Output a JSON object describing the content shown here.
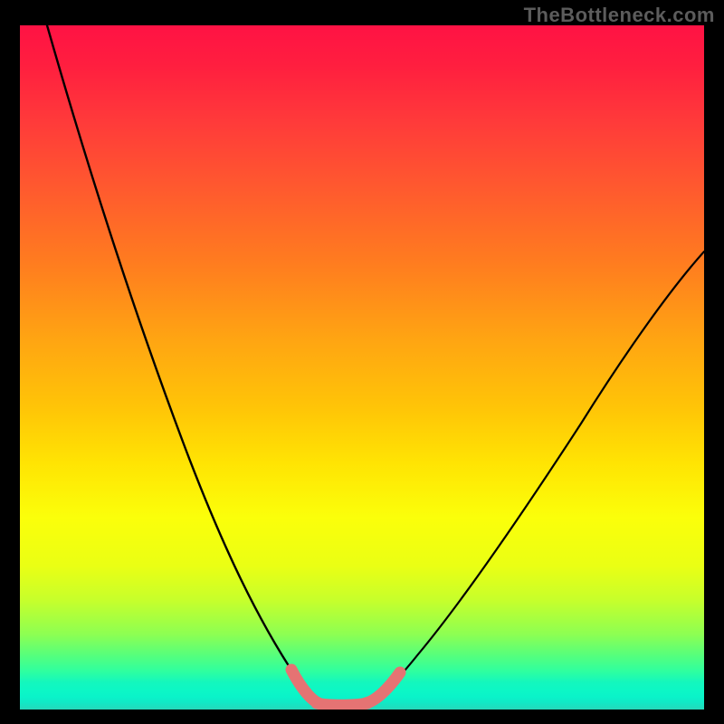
{
  "watermark": "TheBottleneck.com",
  "colors": {
    "background": "#000000",
    "curve": "#000000",
    "highlight": "#e57373",
    "watermark": "#5c5c5c"
  },
  "chart_data": {
    "type": "line",
    "title": "",
    "xlabel": "",
    "ylabel": "",
    "xlim": [
      0,
      100
    ],
    "ylim": [
      0,
      100
    ],
    "grid": false,
    "legend": false,
    "series": [
      {
        "name": "left-curve",
        "x": [
          4,
          8,
          12,
          16,
          20,
          24,
          28,
          32,
          36,
          38,
          40,
          41.5,
          43
        ],
        "y": [
          100,
          84,
          70,
          58,
          47,
          37,
          28,
          20,
          12,
          8,
          4.5,
          2.5,
          1
        ]
      },
      {
        "name": "right-curve",
        "x": [
          50,
          52,
          55,
          60,
          65,
          70,
          75,
          80,
          85,
          90,
          95,
          100
        ],
        "y": [
          1,
          2.5,
          5,
          10,
          16,
          22.5,
          29,
          36,
          43,
          50,
          57,
          64
        ]
      },
      {
        "name": "valley-floor",
        "x": [
          43,
          45,
          47,
          50
        ],
        "y": [
          1,
          0.6,
          0.6,
          1
        ]
      },
      {
        "name": "highlight-left",
        "x": [
          40,
          41.5,
          43
        ],
        "y": [
          4.5,
          2.5,
          1
        ]
      },
      {
        "name": "highlight-floor",
        "x": [
          43,
          45,
          47,
          50
        ],
        "y": [
          1,
          0.6,
          0.6,
          1
        ]
      },
      {
        "name": "highlight-right",
        "x": [
          50,
          52,
          55
        ],
        "y": [
          1,
          2.5,
          5
        ]
      }
    ],
    "gradient_stops": [
      {
        "pos": 0.0,
        "color": "#ff1244"
      },
      {
        "pos": 0.06,
        "color": "#ff1f3f"
      },
      {
        "pos": 0.14,
        "color": "#ff3a3a"
      },
      {
        "pos": 0.24,
        "color": "#ff5a2e"
      },
      {
        "pos": 0.35,
        "color": "#ff7d1f"
      },
      {
        "pos": 0.46,
        "color": "#ffa512"
      },
      {
        "pos": 0.56,
        "color": "#ffc507"
      },
      {
        "pos": 0.64,
        "color": "#ffe403"
      },
      {
        "pos": 0.72,
        "color": "#fbff0a"
      },
      {
        "pos": 0.79,
        "color": "#eaff14"
      },
      {
        "pos": 0.84,
        "color": "#c7ff2b"
      },
      {
        "pos": 0.89,
        "color": "#8dff52"
      },
      {
        "pos": 0.92,
        "color": "#57ff7b"
      },
      {
        "pos": 0.945,
        "color": "#2dffa1"
      },
      {
        "pos": 0.96,
        "color": "#14f7bd"
      },
      {
        "pos": 0.973,
        "color": "#0cf7c6"
      },
      {
        "pos": 0.982,
        "color": "#0af3c9"
      },
      {
        "pos": 0.99,
        "color": "#11e8c6"
      },
      {
        "pos": 1.0,
        "color": "#26d8ba"
      }
    ]
  }
}
